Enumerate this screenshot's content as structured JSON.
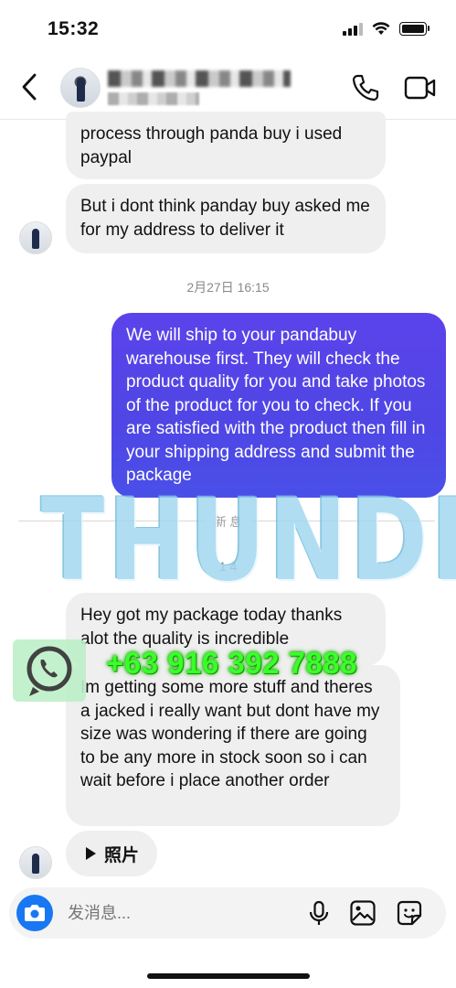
{
  "status_bar": {
    "time": "15:32"
  },
  "header": {},
  "messages": {
    "m1": "process through panda buy i used paypal",
    "m2": "But i dont think panday buy asked me for my address to deliver it",
    "timestamp1": "2月27日 16:15",
    "m3": "We will ship to your pandabuy warehouse first. They will check the product quality for you and take photos of the product for you to check. If you are satisfied with the product then fill in your shipping address and submit the package",
    "new_messages_label": "新 息",
    "timestamp2": "1 4",
    "m4": "Hey got my package today thanks alot the quality is incredible",
    "m5": "Im getting some more stuff and theres a jacked i really want but dont have my size was wondering if there are going to be any more in stock soon so i can wait before i place another order",
    "photo_label": "照片"
  },
  "watermark": {
    "text": "THUNDER",
    "phone": "+63 916 392 7888"
  },
  "composer": {
    "placeholder": "发消息..."
  },
  "colors": {
    "outgoing_bubble": "#4f46e5",
    "incoming_bubble": "#efefef",
    "camera_button": "#1877f2",
    "watermark_phone": "#39ff2a"
  }
}
